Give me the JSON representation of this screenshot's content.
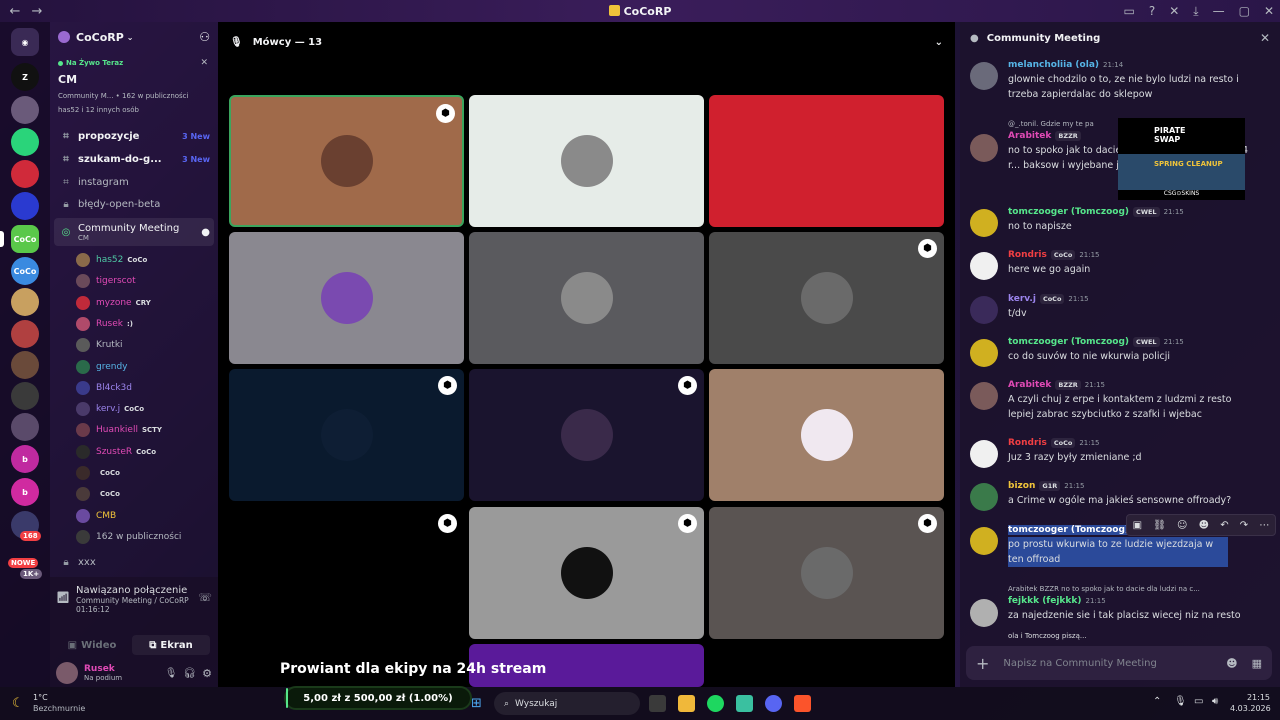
{
  "window": {
    "title": "CoCoRP"
  },
  "guild": {
    "name": "CoCoRP",
    "live": {
      "label": "Na Żywo Teraz",
      "title": "CM",
      "channel": "Community M...",
      "audience": "162 w publiczności",
      "who": "has52 i 12 innych osób"
    },
    "channels": [
      {
        "name": "propozycje",
        "new": "3 New"
      },
      {
        "name": "szukam-do-g...",
        "new": "3 New"
      },
      {
        "name": "instagram"
      },
      {
        "name": "błędy-open-beta"
      },
      {
        "name": "Community Meeting",
        "sub": "CM"
      },
      {
        "name": "xxx"
      }
    ],
    "voice_users": [
      {
        "name": "has52",
        "tag": "CoCo",
        "color": "#4fc9a4"
      },
      {
        "name": "tigerscot",
        "tag": "",
        "color": "#e04ab5"
      },
      {
        "name": "myzone",
        "tag": "CRY",
        "color": "#e04ab5"
      },
      {
        "name": "Rusek",
        "tag": ":)",
        "color": "#e04ab5"
      },
      {
        "name": "Krutki",
        "tag": "",
        "color": "#b5bac1"
      },
      {
        "name": "grendy",
        "tag": "",
        "color": "#56b4e6"
      },
      {
        "name": "Bl4ck3d",
        "tag": "",
        "color": "#9b84ec"
      },
      {
        "name": "kerv.j",
        "tag": "CoCo",
        "color": "#9b84ec"
      },
      {
        "name": "Huankiell",
        "tag": "SCTY",
        "color": "#e04ab5"
      },
      {
        "name": "SzusteR",
        "tag": "CoCo",
        "color": "#e04ab5"
      },
      {
        "name": "",
        "tag": "CoCo",
        "color": "#b5bac1"
      },
      {
        "name": "",
        "tag": "CoCo",
        "color": "#b5bac1"
      },
      {
        "name": "CMB",
        "tag": "",
        "color": "#f0c43a"
      },
      {
        "name": "162 w publiczności",
        "tag": "",
        "color": "#b5bac1"
      }
    ],
    "server_badges": {
      "count": "168",
      "new": "NOWE",
      "plus": "1K+"
    }
  },
  "voice": {
    "status": "Nawiązano połączenie",
    "channel": "Community Meeting / CoCoRP",
    "timer": "01:16:12",
    "video_label": "Wideo",
    "screen_label": "Ekran"
  },
  "user": {
    "name": "Rusek",
    "status": "Na podium"
  },
  "stage": {
    "header": "Mówcy — 13",
    "banner": "Prowiant dla ekipy na 24h stream",
    "goal": "5,00 zł z 500,00 zł (1.00%)"
  },
  "chat": {
    "title": "Community Meeting",
    "input_placeholder": "Napisz na Community Meeting",
    "typing": "ola i Tomczoog piszą...",
    "overlay": {
      "name": "PIRATE SWAP",
      "promo": "SPRING CLEANUP",
      "brand": "CSG⊙SKINS"
    },
    "messages": [
      {
        "name": "melancholiia (ola)",
        "color": "#56b4e6",
        "time": "21:14",
        "text": "glownie chodzilo o to, ze nie bylo ludzi na resto i trzeba zapierdalac do sklepow"
      },
      {
        "reply": "@_.tonil. Gdzie my te pa",
        "name": "Arabitek",
        "tag": "BZZR",
        "color": "#e04ab5",
        "time": "",
        "text": "no to spoko jak to dacie ... siebie ze bierzecie po 4 r... baksow i wyjebane jajo"
      },
      {
        "name": "tomczooger (Tomczoog)",
        "tag": "CWEL",
        "color": "#56e68b",
        "time": "21:15",
        "text": "no to napisze"
      },
      {
        "name": "Rondris",
        "tag": "CoCo",
        "color": "#f23f43",
        "time": "21:15",
        "text": "here we go again"
      },
      {
        "name": "kerv.j",
        "tag": "CoCo",
        "color": "#9b84ec",
        "time": "21:15",
        "text": "t/dv"
      },
      {
        "name": "tomczooger (Tomczoog)",
        "tag": "CWEL",
        "color": "#56e68b",
        "time": "21:15",
        "text": "co do suvów to nie wkurwia policji"
      },
      {
        "name": "Arabitek",
        "tag": "BZZR",
        "color": "#e04ab5",
        "time": "21:15",
        "text": "A czyli chuj z erpe i kontaktem z ludzmi z resto lepiej zabrac szybciutko z szafki i wjebac"
      },
      {
        "name": "Rondris",
        "tag": "CoCo",
        "color": "#f23f43",
        "time": "21:15",
        "text": "Juz 3 razy były zmieniane ;d"
      },
      {
        "name": "bizon",
        "tag": "G1R",
        "color": "#f0c43a",
        "time": "21:15",
        "text": "a Crime w ogóle ma jakieś sensowne offroady?"
      },
      {
        "name": "tomczooger (Tomczoog)",
        "color": "#ffffff",
        "time": "",
        "text": "po prostu wkurwia to ze ludzie wjezdzaja w ten offroad"
      },
      {
        "reply": "Arabitek BZZR no to spoko jak to dacie dla ludzi na c...",
        "name": "fejkkk (fejkkk)",
        "color": "#56e68b",
        "time": "21:15",
        "text": "za najedzenie sie i tak placisz wiecej niz na resto"
      }
    ]
  },
  "taskbar": {
    "weather_temp": "1°C",
    "weather_desc": "Bezchmurnie",
    "search_placeholder": "Wyszukaj",
    "time": "21:15",
    "date": "4.03.2026"
  }
}
